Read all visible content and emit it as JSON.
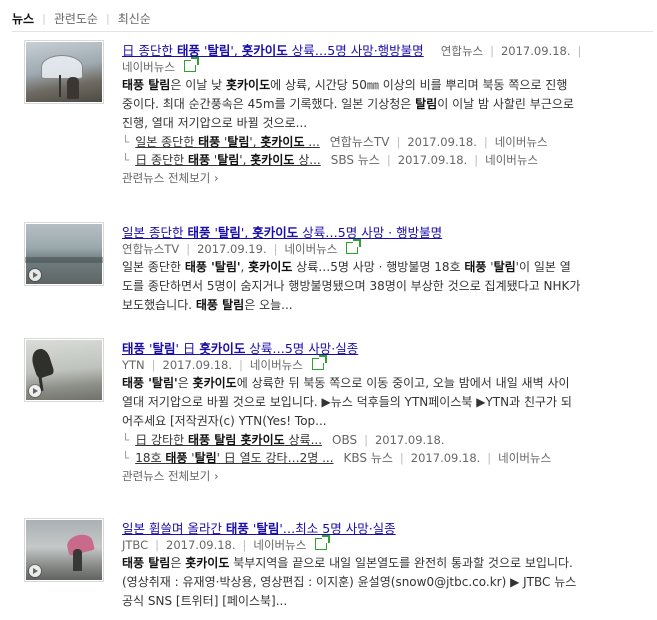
{
  "tabs": [
    {
      "label": "뉴스",
      "active": true
    },
    {
      "label": "관련도순",
      "active": false
    },
    {
      "label": "최신순",
      "active": false
    }
  ],
  "items": [
    {
      "title": [
        "日 종단한 ",
        "태풍",
        " '",
        "탈림",
        "', ",
        "홋카이도",
        " 상륙…5명 사망·행방불명"
      ],
      "meta": [
        {
          "label": "연합뉴스"
        },
        {
          "label": "2017.09.18."
        },
        {
          "label": "네이버뉴스"
        }
      ],
      "desc": [
        [
          "태풍 탈림",
          "은 이날 낮 ",
          "홋카이도",
          "에 상륙, 시간당 50㎜ 이상의 비를 뿌리며 북동 쪽으로 진행"
        ],
        [
          "중이다. 최대 순간풍속은 45m를 기록했다. 일본 기상청은 ",
          "탈림",
          "이 이날 밤 사할린 부근으로"
        ],
        [
          "진행, 열대 저기압으로 바뀔 것으로..."
        ]
      ],
      "related": [
        {
          "title": [
            "일본 종단한 ",
            "태풍",
            " '",
            "탈림",
            "', ",
            "홋카이도",
            " ..."
          ],
          "source": "연합뉴스TV",
          "date": "2017.09.18.",
          "portal": "네이버뉴스"
        },
        {
          "title": [
            "日 종단한 ",
            "태풍",
            " '",
            "탈림",
            "', ",
            "홋카이도",
            " 상..."
          ],
          "source": "SBS 뉴스",
          "date": "2017.09.18.",
          "portal": "네이버뉴스"
        }
      ],
      "more": "관련뉴스 전체보기"
    },
    {
      "title": [
        "일본 종단한 ",
        "태풍",
        " '",
        "탈림",
        "', ",
        "홋카이도",
        " 상륙…5명 사망 · 행방불명"
      ],
      "meta": [
        {
          "label": "연합뉴스TV"
        },
        {
          "label": "2017.09.19."
        },
        {
          "label": "네이버뉴스"
        }
      ],
      "desc": [
        [
          "일본 종단한 ",
          "태풍 '탈림'",
          ", ",
          "홋카이도",
          " 상륙…5명 사망 · 행방불명 18호 ",
          "태풍",
          " '",
          "탈림",
          "'이 일본 열"
        ],
        [
          "도를 종단하면서 5명이 숨지거나 행방불명됐으며 38명이 부상한 것으로 집계됐다고 NHK가"
        ],
        [
          "보도했습니다. ",
          "태풍 탈림",
          "은 오늘..."
        ]
      ],
      "related": [],
      "more": ""
    },
    {
      "title": [
        "태풍",
        " '",
        "탈림",
        "' 日 ",
        "홋카이도",
        " 상륙…5명 사망·실종"
      ],
      "meta": [
        {
          "label": "YTN"
        },
        {
          "label": "2017.09.18."
        },
        {
          "label": "네이버뉴스"
        }
      ],
      "desc": [
        [
          "태풍 '탈림'",
          "은 ",
          "홋카이도",
          "에 상륙한 뒤 북동 쪽으로 이동 중이고, 오늘 밤에서 내일 새벽 사이"
        ],
        [
          "열대 저기압으로 바뀔 것으로 보입니다. ▶뉴스 덕후들의 YTN페이스북 ▶YTN과 친구가 되"
        ],
        [
          "어주세요 [저작권자(c) YTN(Yes! Top..."
        ]
      ],
      "related": [
        {
          "title": [
            "日 강타한 ",
            "태풍 탈림 홋카이도",
            " 상륙..."
          ],
          "source": "OBS",
          "date": "2017.09.18.",
          "portal": ""
        },
        {
          "title": [
            "18호 ",
            "태풍",
            " '",
            "탈림",
            "' 日 열도 강타…2명 ..."
          ],
          "source": "KBS 뉴스",
          "date": "2017.09.18.",
          "portal": "네이버뉴스"
        }
      ],
      "more": "관련뉴스 전체보기"
    },
    {
      "title": [
        "일본 휩쓸며 올라간 ",
        "태풍",
        " '",
        "탈림",
        "'…최소 5명 사망·실종"
      ],
      "meta": [
        {
          "label": "JTBC"
        },
        {
          "label": "2017.09.18."
        },
        {
          "label": "네이버뉴스"
        }
      ],
      "desc": [
        [
          "태풍 탈림",
          "은 ",
          "홋카이도",
          " 북부지역을 끝으로 내일 일본열도를 완전히 통과할 것으로 보입니다."
        ],
        [
          "(영상취재 : 유재영·박상용, 영상편집 : 이지훈) 윤설영(snow0@jtbc.co.kr) ▶ JTBC 뉴스"
        ],
        [
          "공식 SNS [트위터] [페이스북]..."
        ]
      ],
      "related": [],
      "more": ""
    }
  ],
  "colors": {
    "link": "#1a0dab",
    "meta": "#666666",
    "share_icon": "#2fa12f"
  },
  "icons": {
    "share": "share-icon",
    "video": "play-icon"
  }
}
